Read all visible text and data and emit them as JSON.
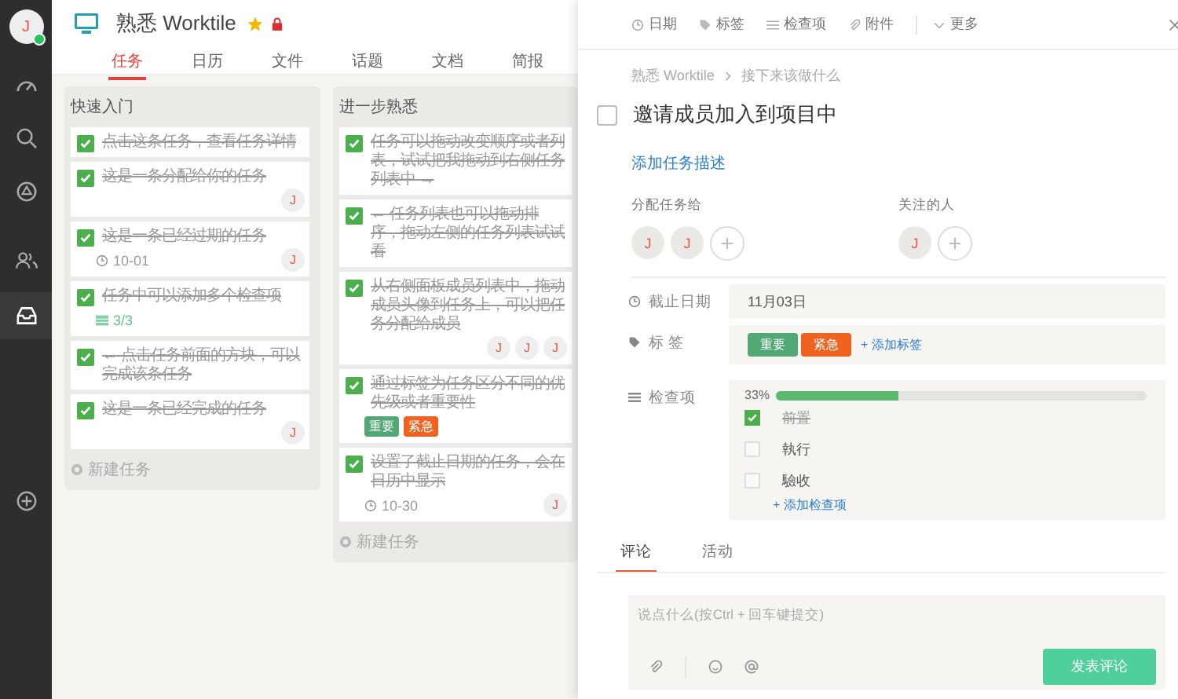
{
  "sidebar": {
    "avatar": "J",
    "online": true
  },
  "project": {
    "title": "熟悉 Worktile",
    "starred": true,
    "locked": true
  },
  "tabs": [
    {
      "label": "任务",
      "selected": true
    },
    {
      "label": "日历",
      "selected": false
    },
    {
      "label": "文件",
      "selected": false
    },
    {
      "label": "话题",
      "selected": false
    },
    {
      "label": "文档",
      "selected": false
    },
    {
      "label": "简报",
      "selected": false
    }
  ],
  "columns": [
    {
      "title": "快速入门",
      "add_label": "新建任务",
      "cards": [
        {
          "title": "点击这条任务，查看任务详情",
          "done": true
        },
        {
          "title": "这是一条分配给你的任务",
          "done": true,
          "avatars": [
            "J"
          ]
        },
        {
          "title": "这是一条已经过期的任务",
          "done": true,
          "date": "10-01",
          "avatars": [
            "J"
          ]
        },
        {
          "title": "任务中可以添加多个检查项",
          "done": true,
          "checklist": "3/3"
        },
        {
          "title": "← 点击任务前面的方块，可以完成该条任务",
          "done": true
        },
        {
          "title": "这是一条已经完成的任务",
          "done": true,
          "avatars": [
            "J"
          ]
        }
      ]
    },
    {
      "title": "进一步熟悉",
      "add_label": "新建任务",
      "cards": [
        {
          "title": "任务可以拖动改变顺序或者列表，试试把我拖动到右侧任务列表中 →",
          "done": true
        },
        {
          "title": "← 任务列表也可以拖动排序，拖动左侧的任务列表试试看",
          "done": true
        },
        {
          "title": "从右侧面板成员列表中，拖动成员头像到任务上，可以把任务分配给成员",
          "done": true,
          "avatars": [
            "J",
            "J",
            "J"
          ]
        },
        {
          "title": "通过标签为任务区分不同的优先级或者重要性",
          "done": true,
          "tags": [
            {
              "label": "重要",
              "color": "#52a874"
            },
            {
              "label": "紧急",
              "color": "#f0621f"
            }
          ]
        },
        {
          "title": "设置了截止日期的任务，会在日历中显示",
          "done": true,
          "date": "10-30",
          "avatars": [
            "J"
          ]
        }
      ]
    }
  ],
  "detail": {
    "toolbar": [
      {
        "label": "日期",
        "kind": "date"
      },
      {
        "label": "标签",
        "kind": "tag"
      },
      {
        "label": "检查项",
        "kind": "list"
      },
      {
        "label": "附件",
        "kind": "clip"
      },
      {
        "label": "更多",
        "kind": "more"
      }
    ],
    "breadcrumb": [
      "熟悉 Worktile",
      "接下来该做什么"
    ],
    "title": "邀请成员加入到项目中",
    "done": false,
    "description_link": "添加任务描述",
    "assignees": {
      "label": "分配任务给",
      "avatars": [
        "J",
        "J"
      ]
    },
    "followers": {
      "label": "关注的人",
      "avatars": [
        "J"
      ]
    },
    "due": {
      "label": "截止日期",
      "value": "11月03日"
    },
    "tags": {
      "label": "标 签",
      "items": [
        {
          "label": "重要",
          "color": "#52a874"
        },
        {
          "label": "紧急",
          "color": "#f0621f"
        }
      ],
      "add": "+ 添加标签"
    },
    "checklist": {
      "label": "检查项",
      "percent": "33%",
      "level": 0.33,
      "items": [
        {
          "label": "前置",
          "checked": true
        },
        {
          "label": "執行",
          "checked": false
        },
        {
          "label": "驗收",
          "checked": false
        }
      ],
      "add": "+ 添加检查项"
    },
    "comment_tabs": [
      {
        "label": "评论",
        "selected": true
      },
      {
        "label": "活动",
        "selected": false
      }
    ],
    "comment_placeholder": "说点什么(按Ctrl + 回车键提交)",
    "send": "发表评论"
  }
}
